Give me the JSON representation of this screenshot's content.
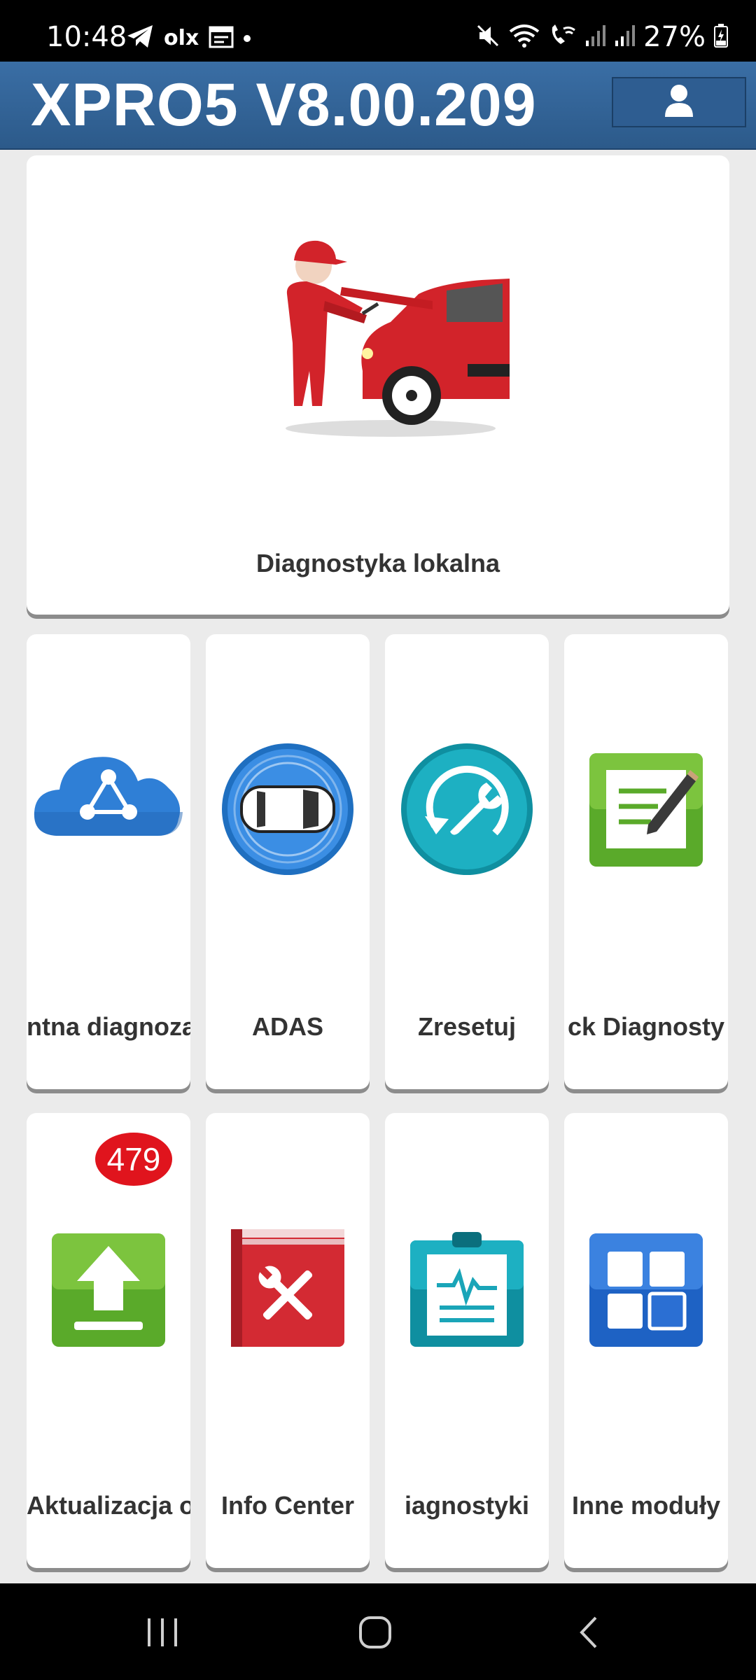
{
  "status_bar": {
    "time": "10:48",
    "left_icons": [
      "telegram-icon",
      "olx-icon",
      "calendar-icon",
      "dot-icon"
    ],
    "olx_text": "olx",
    "right_icons": [
      "mute-icon",
      "wifi-icon",
      "wifi-call-icon",
      "signal-icon",
      "signal-icon",
      "battery-icon"
    ],
    "battery": "27%"
  },
  "header": {
    "title": "XPRO5 V8.00.209",
    "user_icon": "user-icon"
  },
  "main_card": {
    "label": "Diagnostyka lokalna",
    "icon": "mechanic-car-icon"
  },
  "tiles": [
    {
      "label": "ntna diagnoza",
      "icon": "cloud-network-icon"
    },
    {
      "label": "ADAS",
      "icon": "adas-car-icon"
    },
    {
      "label": "Zresetuj",
      "icon": "reset-wrench-icon"
    },
    {
      "label": "ck Diagnosty",
      "icon": "notepad-icon"
    },
    {
      "label": "Aktualizacja o",
      "icon": "upload-icon",
      "badge": "479"
    },
    {
      "label": "Info Center",
      "icon": "toolbook-icon"
    },
    {
      "label": "iagnostyki",
      "icon": "clipboard-waveform-icon"
    },
    {
      "label": "Inne moduły",
      "icon": "modules-grid-icon"
    }
  ],
  "nav_bar": {
    "buttons": [
      "recent-apps-icon",
      "home-icon",
      "back-icon"
    ]
  },
  "colors": {
    "header": "#2f5f92",
    "badge": "#e0141d",
    "background": "#ebebeb"
  }
}
